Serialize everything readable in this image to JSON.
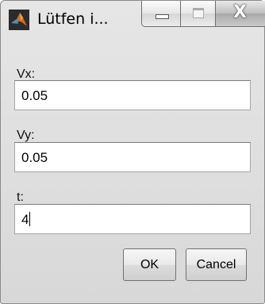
{
  "window": {
    "title": "Lütfen i...",
    "close_glyph": "X"
  },
  "fields": [
    {
      "label": "Vx:",
      "value": "0.05"
    },
    {
      "label": "Vy:",
      "value": "0.05"
    },
    {
      "label": "t:",
      "value": "4"
    }
  ],
  "buttons": {
    "ok_label": "OK",
    "cancel_label": "Cancel"
  },
  "icons": {
    "app": "matlab-icon",
    "minimize": "minimize-icon",
    "maximize": "maximize-icon",
    "close": "close-icon"
  }
}
